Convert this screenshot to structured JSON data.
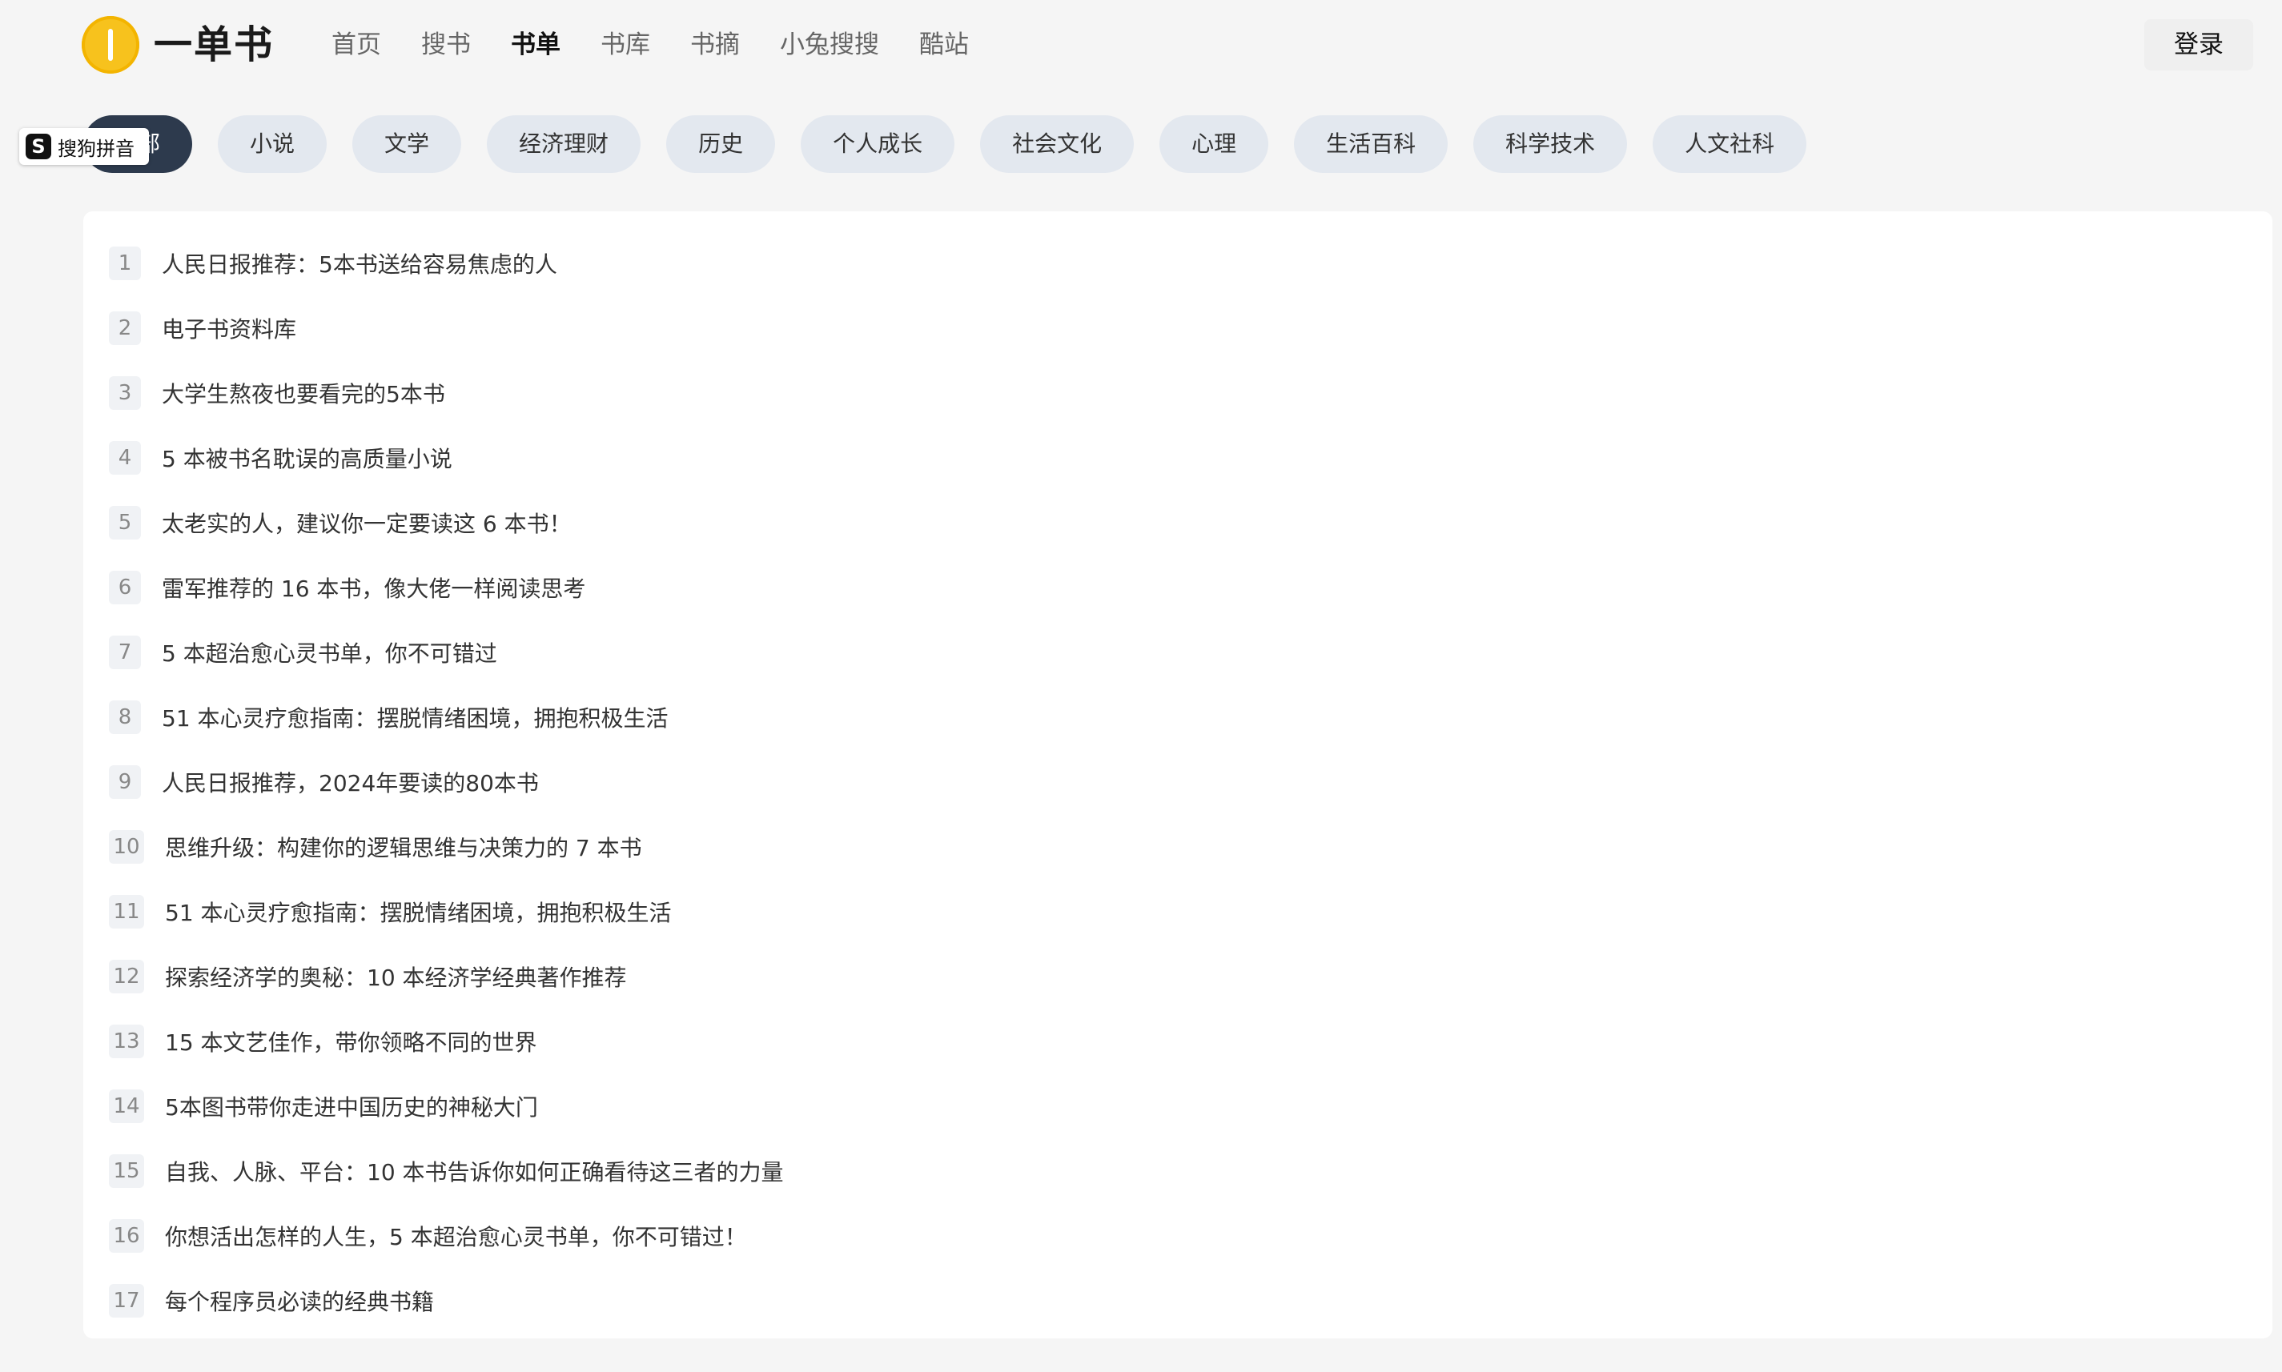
{
  "brand": {
    "name": "一单书",
    "logo_icon": "coin-logo-icon",
    "logo_color": "#f7c21d"
  },
  "nav": {
    "items": [
      {
        "label": "首页",
        "active": false
      },
      {
        "label": "搜书",
        "active": false
      },
      {
        "label": "书单",
        "active": true
      },
      {
        "label": "书库",
        "active": false
      },
      {
        "label": "书摘",
        "active": false
      },
      {
        "label": "小兔搜搜",
        "active": false
      },
      {
        "label": "酷站",
        "active": false
      }
    ]
  },
  "header": {
    "login_label": "登录"
  },
  "categories": {
    "active_color": "#2d3a4d",
    "items": [
      {
        "label": "全部",
        "active": true
      },
      {
        "label": "小说"
      },
      {
        "label": "文学"
      },
      {
        "label": "经济理财"
      },
      {
        "label": "历史"
      },
      {
        "label": "个人成长"
      },
      {
        "label": "社会文化"
      },
      {
        "label": "心理"
      },
      {
        "label": "生活百科"
      },
      {
        "label": "科学技术"
      },
      {
        "label": "人文社科"
      }
    ]
  },
  "ime": {
    "icon": "sogou-s-icon",
    "logo_letter": "S",
    "label": "搜狗拼音"
  },
  "booklists": [
    {
      "rank": "1",
      "title": "人民日报推荐：5本书送给容易焦虑的人"
    },
    {
      "rank": "2",
      "title": "电子书资料库"
    },
    {
      "rank": "3",
      "title": "大学生熬夜也要看完的5本书"
    },
    {
      "rank": "4",
      "title": "5 本被书名耽误的高质量小说"
    },
    {
      "rank": "5",
      "title": "太老实的人，建议你一定要读这 6 本书！"
    },
    {
      "rank": "6",
      "title": "雷军推荐的 16 本书，像大佬一样阅读思考"
    },
    {
      "rank": "7",
      "title": "5 本超治愈心灵书单，你不可错过"
    },
    {
      "rank": "8",
      "title": "51 本心灵疗愈指南：摆脱情绪困境，拥抱积极生活"
    },
    {
      "rank": "9",
      "title": "人民日报推荐，2024年要读的80本书"
    },
    {
      "rank": "10",
      "title": "思维升级：构建你的逻辑思维与决策力的 7 本书"
    },
    {
      "rank": "11",
      "title": "51 本心灵疗愈指南：摆脱情绪困境，拥抱积极生活"
    },
    {
      "rank": "12",
      "title": "探索经济学的奥秘：10 本经济学经典著作推荐"
    },
    {
      "rank": "13",
      "title": "15 本文艺佳作，带你领略不同的世界"
    },
    {
      "rank": "14",
      "title": "5本图书带你走进中国历史的神秘大门"
    },
    {
      "rank": "15",
      "title": "自我、人脉、平台：10 本书告诉你如何正确看待这三者的力量"
    },
    {
      "rank": "16",
      "title": "你想活出怎样的人生，5 本超治愈心灵书单，你不可错过！"
    },
    {
      "rank": "17",
      "title": "每个程序员必读的经典书籍"
    }
  ]
}
